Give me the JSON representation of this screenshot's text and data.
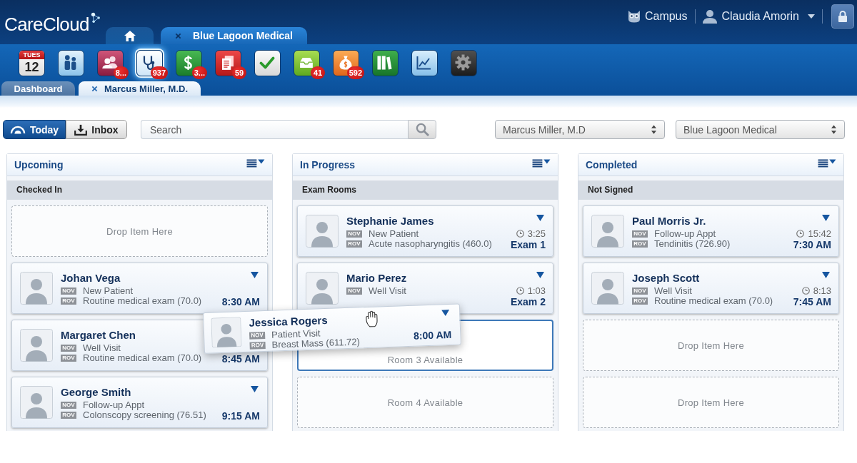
{
  "header": {
    "logo": "CareCloud",
    "tabs": [
      {
        "kind": "home",
        "selected": false,
        "closable": false
      },
      {
        "kind": "practice",
        "label": "Blue Lagoon Medical",
        "selected": true,
        "closable": true
      }
    ],
    "campus": "Campus",
    "user": "Claudia Amorin"
  },
  "toolbar": [
    {
      "kind": "calendar",
      "day": "TUES",
      "date": "12",
      "selected": false
    },
    {
      "kind": "contacts",
      "selected": false
    },
    {
      "kind": "patients",
      "badge": "8...",
      "selected": false
    },
    {
      "kind": "clinical",
      "badge": "937",
      "selected": true
    },
    {
      "kind": "billing",
      "badge": "3...",
      "selected": false
    },
    {
      "kind": "documents",
      "badge": "59",
      "selected": false
    },
    {
      "kind": "tasks",
      "selected": false
    },
    {
      "kind": "messages",
      "badge": "41",
      "selected": false
    },
    {
      "kind": "payments",
      "badge": "592",
      "selected": false
    },
    {
      "kind": "library",
      "selected": false
    },
    {
      "kind": "reports",
      "selected": false
    },
    {
      "kind": "settings",
      "selected": false
    }
  ],
  "subtabs": [
    {
      "label": "Dashboard",
      "selected": false,
      "closable": false
    },
    {
      "label": "Marcus Miller, M.D.",
      "selected": true,
      "closable": true
    }
  ],
  "view_toggle": [
    {
      "kind": "today",
      "label": "Today",
      "selected": true
    },
    {
      "kind": "inbox",
      "label": "Inbox",
      "selected": false
    }
  ],
  "search": {
    "placeholder": "Search"
  },
  "filters": [
    {
      "value": "Marcus Miller, M.D"
    },
    {
      "value": "Blue Lagoon Medical"
    }
  ],
  "columns": [
    {
      "title": "Upcoming",
      "section": "Checked In",
      "slots": [
        {
          "kind": "drop",
          "label": "Drop Item Here",
          "highlighted": false
        },
        {
          "kind": "card",
          "name": "Johan Vega",
          "reasons": [
            {
              "tag": "NOV",
              "text": "New Patient"
            },
            {
              "tag": "ROV",
              "text": "Routine medical exam (70.0)"
            }
          ],
          "time": "8:30 AM",
          "menu": true
        },
        {
          "kind": "card",
          "name": "Margaret Chen",
          "reasons": [
            {
              "tag": "NOV",
              "text": "Well Visit"
            },
            {
              "tag": "ROV",
              "text": "Routine medical exam (70.0)"
            }
          ],
          "time": "8:45 AM",
          "menu": false
        },
        {
          "kind": "card",
          "name": "George Smith",
          "reasons": [
            {
              "tag": "NOV",
              "text": "Follow-up Appt"
            },
            {
              "tag": "ROV",
              "text": "Colonscopy screening (76.51)"
            }
          ],
          "time": "9:15 AM",
          "menu": true
        }
      ]
    },
    {
      "title": "In Progress",
      "section": "Exam Rooms",
      "slots": [
        {
          "kind": "card",
          "name": "Stephanie James",
          "reasons": [
            {
              "tag": "NOV",
              "text": "New Patient"
            },
            {
              "tag": "ROV",
              "text": "Acute nasopharyngitis (460.0)"
            }
          ],
          "duration": "3:25",
          "room": "Exam 1",
          "menu": true
        },
        {
          "kind": "card",
          "name": "Mario Perez",
          "reasons": [
            {
              "tag": "NOV",
              "text": "Well Visit"
            }
          ],
          "duration": "1:03",
          "room": "Exam 2",
          "menu": true
        },
        {
          "kind": "drop",
          "label": "Room 3 Available",
          "highlighted": true
        },
        {
          "kind": "drop",
          "label": "Room 4 Available",
          "highlighted": false
        }
      ]
    },
    {
      "title": "Completed",
      "section": "Not Signed",
      "slots": [
        {
          "kind": "card",
          "name": "Paul Morris Jr.",
          "reasons": [
            {
              "tag": "NOV",
              "text": "Follow-up Appt"
            },
            {
              "tag": "ROV",
              "text": "Tendinitis (726.90)"
            }
          ],
          "duration": "15:42",
          "time": "7:30 AM",
          "menu": true
        },
        {
          "kind": "card",
          "name": "Joseph Scott",
          "reasons": [
            {
              "tag": "NOV",
              "text": "Well Visit"
            },
            {
              "tag": "ROV",
              "text": "Routine medical exam (70.0)"
            }
          ],
          "duration": "8:13",
          "time": "7:45 AM",
          "menu": true
        },
        {
          "kind": "drop",
          "label": "Drop Item Here",
          "highlighted": false
        },
        {
          "kind": "drop",
          "label": "Drop Item Here",
          "highlighted": false
        }
      ]
    }
  ],
  "dragged_card": {
    "name": "Jessica Rogers",
    "reasons": [
      {
        "tag": "NOV",
        "text": "Patient Visit"
      },
      {
        "tag": "ROV",
        "text": "Breast Mass (611.72)"
      }
    ],
    "time": "8:00 AM",
    "menu": true
  }
}
